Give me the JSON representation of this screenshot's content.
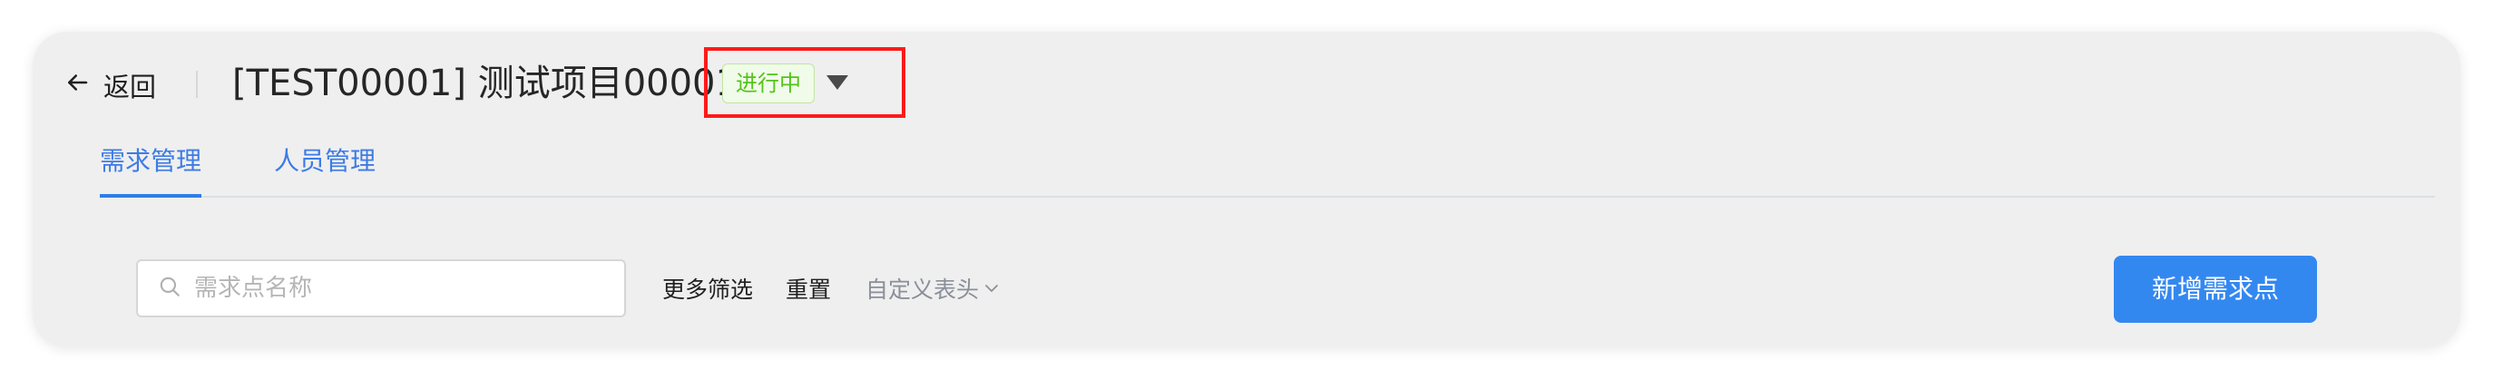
{
  "header": {
    "back_label": "返回",
    "title": "[TEST00001] 测试项目00001",
    "status": "进行中"
  },
  "tabs": [
    {
      "label": "需求管理",
      "active": true
    },
    {
      "label": "人员管理",
      "active": false
    }
  ],
  "toolbar": {
    "search_placeholder": "需求点名称",
    "more_filters": "更多筛选",
    "reset": "重置",
    "custom_header": "自定义表头",
    "add_button": "新增需求点"
  },
  "colors": {
    "accent": "#3388f0",
    "status_green": "#52c41a",
    "highlight_red": "#ff1a1a"
  },
  "icons": {
    "back": "arrow-left-icon",
    "status_dropdown": "caret-down-icon",
    "search": "search-icon",
    "custom_header_chevron": "chevron-down-icon"
  }
}
